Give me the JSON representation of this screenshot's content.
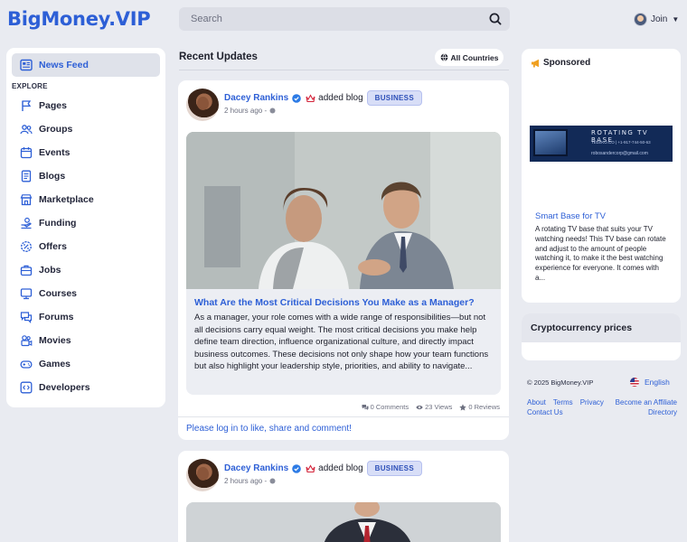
{
  "header": {
    "logo": "BigMoney.VIP",
    "search_placeholder": "Search",
    "join_label": "Join"
  },
  "nav": {
    "active": "News Feed",
    "section_label": "EXPLORE",
    "items": [
      "Pages",
      "Groups",
      "Events",
      "Blogs",
      "Marketplace",
      "Funding",
      "Offers",
      "Jobs",
      "Courses",
      "Forums",
      "Movies",
      "Games",
      "Developers"
    ]
  },
  "feed": {
    "title": "Recent Updates",
    "filter_label": "All Countries",
    "posts": [
      {
        "author": "Dacey Rankins",
        "action": "added blog",
        "badge": "BUSINESS",
        "time": "2 hours ago -",
        "article_title": "What Are the Most Critical Decisions You Make as a Manager?",
        "article_excerpt": "As a manager, your role comes with a wide range of responsibilities—but not all decisions carry equal weight. The most critical decisions you make help define team direction, influence organizational culture, and directly impact business outcomes. These decisions not only shape how your team functions but also highlight your leadership style, priorities, and ability to navigate...",
        "comments": "0 Comments",
        "views": "23 Views",
        "reviews": "0 Reviews",
        "login_prompt": "Please log in to like, share and comment!"
      },
      {
        "author": "Dacey Rankins",
        "action": "added blog",
        "badge": "BUSINESS",
        "time": "2 hours ago -"
      }
    ]
  },
  "sponsor": {
    "heading": "Sponsored",
    "banner_line1": "ROTATING TV BASE",
    "banner_line2": "TELEKO.CO | +1-917-744-50-63",
    "banner_line3": "robosandercorp@gmail.com",
    "ad_title": "Smart Base for TV",
    "ad_description": "A rotating TV base that suits your TV watching needs! This TV base can rotate and adjust to the amount of people watching it, to make it the best watching experience for everyone. It comes with a..."
  },
  "crypto": {
    "title": "Cryptocurrency prices"
  },
  "footer": {
    "copyright": "© 2025 BigMoney.VIP",
    "language": "English",
    "links": [
      "About",
      "Terms",
      "Privacy",
      "Become an Affiliate",
      "Contact Us",
      "Directory"
    ]
  },
  "colors": {
    "brand": "#2d5fd6",
    "background": "#e9ebf1",
    "badge_bg": "#d8def7"
  }
}
